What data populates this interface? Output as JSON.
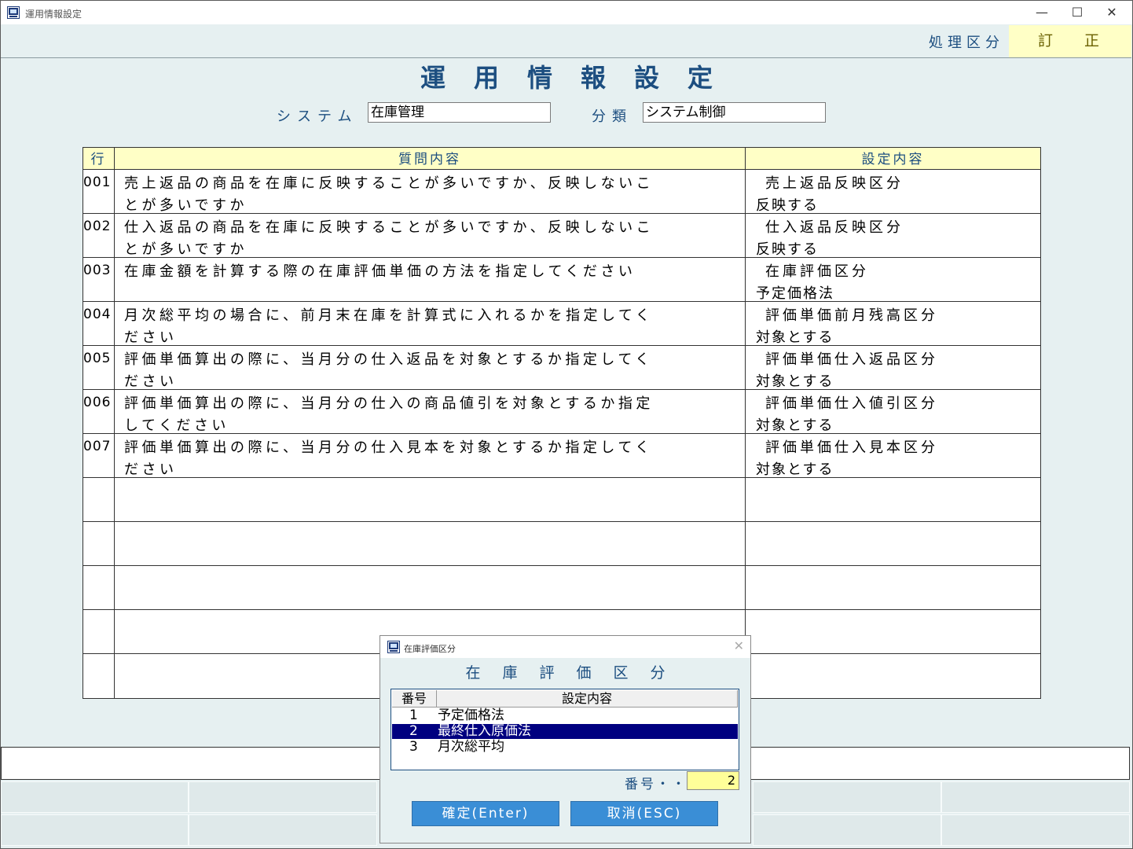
{
  "window": {
    "title": "運用情報設定"
  },
  "mode": {
    "label": "処理区分",
    "value_1": "訂",
    "value_2": "正"
  },
  "page": {
    "title": "運用情報設定"
  },
  "filters": {
    "system_label": "システム",
    "system_value": "在庫管理",
    "category_label": "分類",
    "category_value": "システム制御"
  },
  "grid": {
    "headers": {
      "row": "行",
      "question": "質問内容",
      "setting": "設定内容"
    },
    "rows": [
      {
        "no": "001",
        "q1": "売上返品の商品を在庫に反映することが多いですか、反映しないこ",
        "q2": "とが多いですか",
        "s1": "売上返品反映区分",
        "s2": "反映する"
      },
      {
        "no": "002",
        "q1": "仕入返品の商品を在庫に反映することが多いですか、反映しないこ",
        "q2": "とが多いですか",
        "s1": "仕入返品反映区分",
        "s2": "反映する"
      },
      {
        "no": "003",
        "q1": "在庫金額を計算する際の在庫評価単価の方法を指定してください",
        "q2": "",
        "s1": "在庫評価区分",
        "s2": "予定価格法"
      },
      {
        "no": "004",
        "q1": "月次総平均の場合に、前月末在庫を計算式に入れるかを指定してく",
        "q2": "ださい",
        "s1": "評価単価前月残高区分",
        "s2": "対象とする"
      },
      {
        "no": "005",
        "q1": "評価単価算出の際に、当月分の仕入返品を対象とするか指定してく",
        "q2": "ださい",
        "s1": "評価単価仕入返品区分",
        "s2": "対象とする"
      },
      {
        "no": "006",
        "q1": "評価単価算出の際に、当月分の仕入の商品値引を対象とするか指定",
        "q2": "してください",
        "s1": "評価単価仕入値引区分",
        "s2": "対象とする"
      },
      {
        "no": "007",
        "q1": "評価単価算出の際に、当月分の仕入見本を対象とするか指定してく",
        "q2": "ださい",
        "s1": "評価単価仕入見本区分",
        "s2": "対象とする"
      }
    ]
  },
  "dialog": {
    "title": "在庫評価区分",
    "heading": "在庫評価区分",
    "list_headers": {
      "no": "番号",
      "content": "設定内容"
    },
    "options": [
      {
        "no": "1",
        "label": "予定価格法"
      },
      {
        "no": "2",
        "label": "最終仕入原価法"
      },
      {
        "no": "3",
        "label": "月次総平均"
      }
    ],
    "number_label": "番号・・・",
    "number_value": "2",
    "ok_label": "確定(Enter)",
    "cancel_label": "取消(ESC)"
  },
  "colors": {
    "accent": "#1c4e80",
    "highlight": "#ffffc6",
    "selected": "#000080",
    "button": "#3a8ed6"
  },
  "icons": {
    "app": "app-window-icon",
    "minimize": "minimize-icon",
    "maximize": "maximize-icon",
    "close": "close-icon"
  }
}
